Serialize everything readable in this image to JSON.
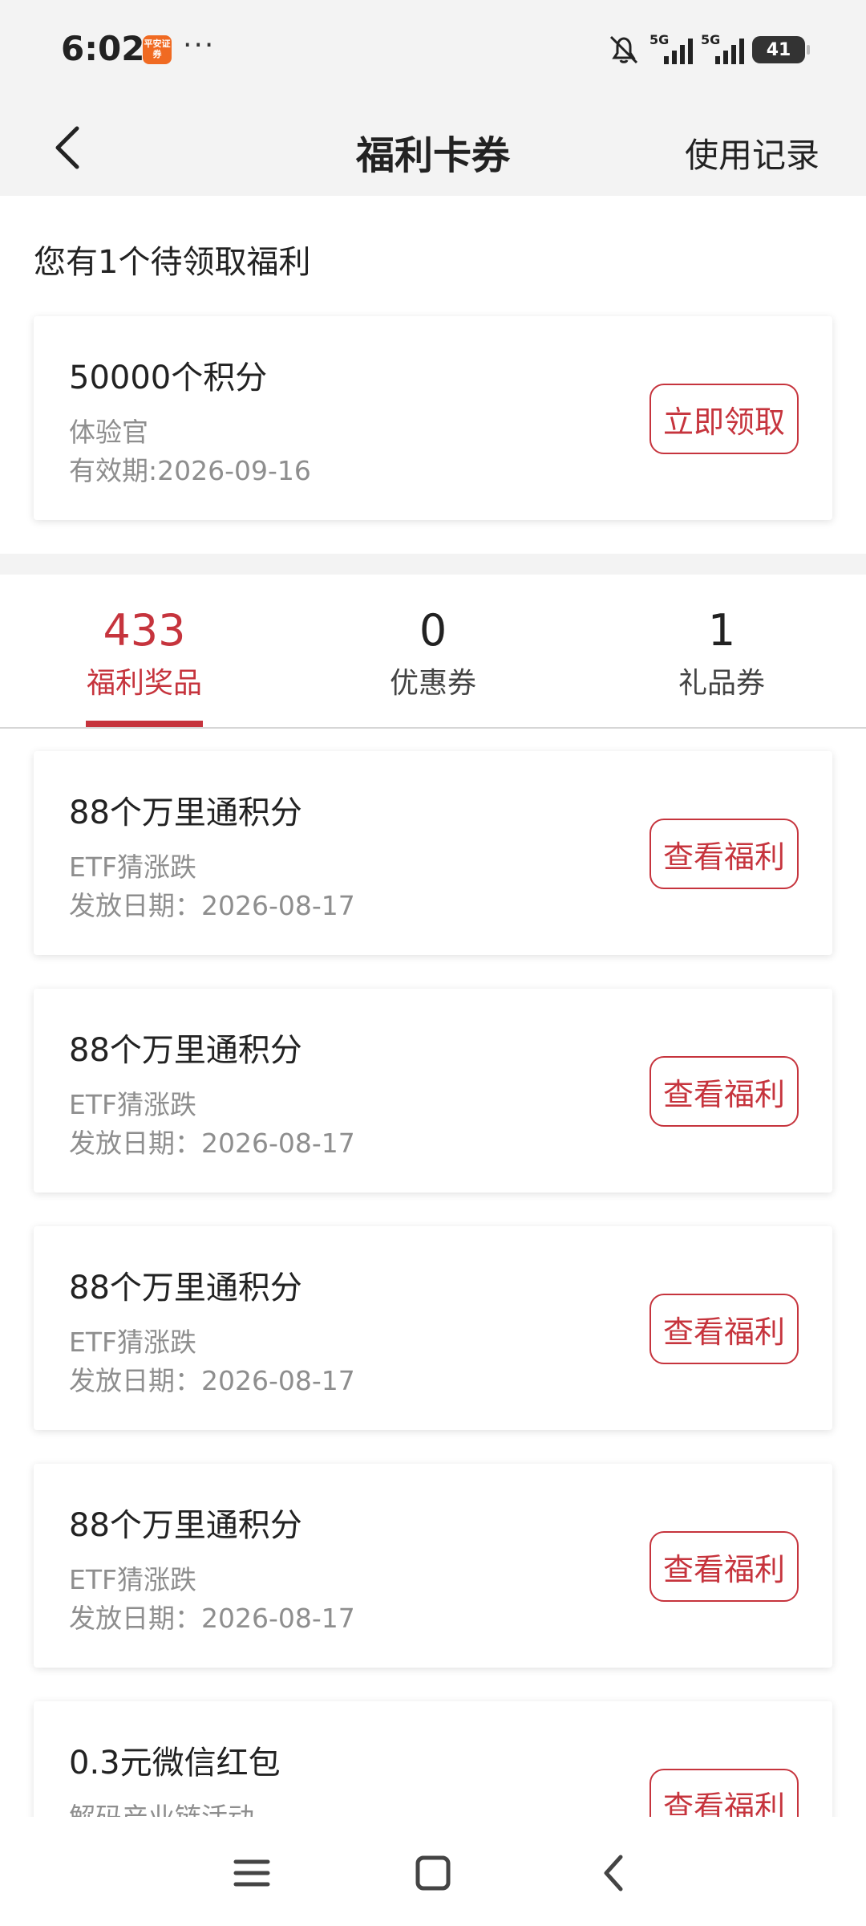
{
  "status_bar": {
    "time": "6:02",
    "app_icon_text": "平安证券",
    "more": "···",
    "signal_1_label": "5G",
    "signal_2_label": "5G",
    "battery": "41"
  },
  "header": {
    "title": "福利卡券",
    "history_link": "使用记录"
  },
  "pending": {
    "hint": "您有1个待领取福利",
    "card": {
      "title": "50000个积分",
      "source": "体验官",
      "validity": "有效期:2026-09-16",
      "button": "立即领取"
    }
  },
  "tabs": [
    {
      "count": "433",
      "label": "福利奖品",
      "active": true
    },
    {
      "count": "0",
      "label": "优惠券",
      "active": false
    },
    {
      "count": "1",
      "label": "礼品券",
      "active": false
    }
  ],
  "items": [
    {
      "title": "88个万里通积分",
      "source": "ETF猜涨跌",
      "date": "发放日期：2026-08-17",
      "button": "查看福利"
    },
    {
      "title": "88个万里通积分",
      "source": "ETF猜涨跌",
      "date": "发放日期：2026-08-17",
      "button": "查看福利"
    },
    {
      "title": "88个万里通积分",
      "source": "ETF猜涨跌",
      "date": "发放日期：2026-08-17",
      "button": "查看福利"
    },
    {
      "title": "88个万里通积分",
      "source": "ETF猜涨跌",
      "date": "发放日期：2026-08-17",
      "button": "查看福利"
    },
    {
      "title": "0.3元微信红包",
      "source": "解码产业链活动",
      "date": "",
      "button": "查看福利"
    }
  ],
  "colors": {
    "accent": "#c6343d",
    "background": "#f3f3f3"
  }
}
